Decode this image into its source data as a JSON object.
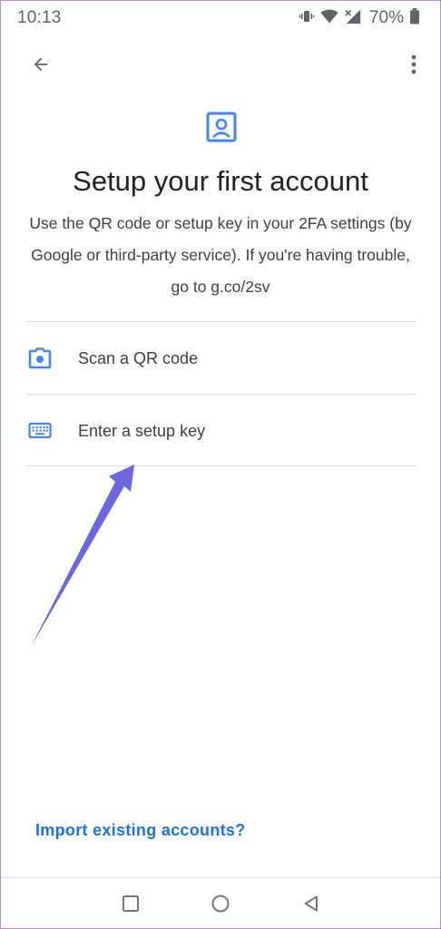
{
  "status_bar": {
    "time": "10:13",
    "battery_percent": "70%",
    "icons": [
      "vibrate-icon",
      "wifi-icon",
      "cellular-signal-icon",
      "battery-icon"
    ]
  },
  "app_bar": {
    "back_icon": "arrow-back-icon",
    "more_icon": "more-vert-icon"
  },
  "header": {
    "icon": "account-box-icon",
    "title": "Setup your first account",
    "description": "Use the QR code or setup key in your 2FA settings (by Google or third-party service). If you're having trouble, go to g.co/2sv"
  },
  "options": [
    {
      "icon": "camera-icon",
      "label": "Scan a QR code"
    },
    {
      "icon": "keyboard-icon",
      "label": "Enter a setup key"
    }
  ],
  "footer": {
    "import_link": "Import existing accounts?"
  },
  "nav": {
    "icons": [
      "recents-square-icon",
      "home-circle-icon",
      "back-triangle-icon"
    ]
  },
  "colors": {
    "accent": "#1a73e8",
    "icon_blue": "#4285f4",
    "annotation_arrow": "#6a67e0",
    "frame_border": "#b389d9"
  }
}
